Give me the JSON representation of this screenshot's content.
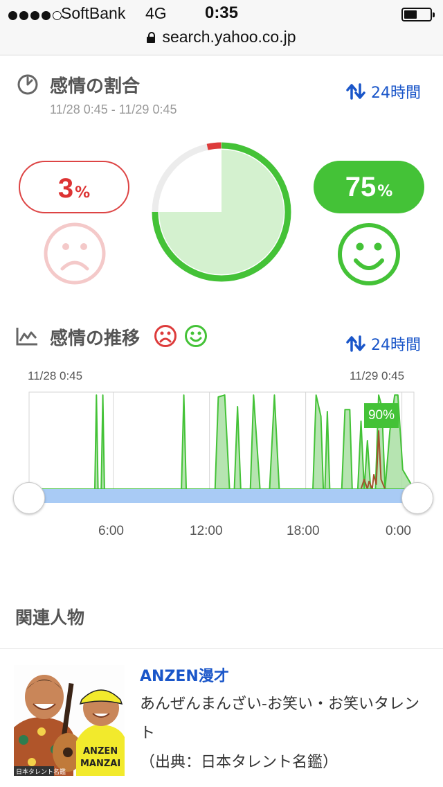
{
  "status_bar": {
    "carrier": "SoftBank",
    "network": "4G",
    "time": "0:35",
    "url": "search.yahoo.co.jp"
  },
  "ratio": {
    "title": "感情の割合",
    "range_label": "24時間",
    "date_range": "11/28 0:45 - 11/29 0:45",
    "negative_value": "3",
    "positive_value": "75",
    "percent_sign": "%",
    "neutral_value": 22
  },
  "trend": {
    "title": "感情の推移",
    "range_label": "24時間",
    "start_date": "11/28 0:45",
    "end_date": "11/29 0:45",
    "peak_label": "90%",
    "hour_labels": [
      "6:00",
      "12:00",
      "18:00",
      "0:00"
    ]
  },
  "chart_data": {
    "type": "area",
    "xlabel": "",
    "ylabel": "",
    "x_range": [
      "11/28 0:45",
      "11/29 0:45"
    ],
    "categories": [
      "6:00",
      "12:00",
      "18:00",
      "0:00"
    ],
    "ylim": [
      0,
      100
    ],
    "series": [
      {
        "points": [
          [
            4.1,
            0
          ],
          [
            4.2,
            97
          ],
          [
            4.3,
            0
          ],
          [
            4.5,
            0
          ],
          [
            4.6,
            97
          ],
          [
            4.7,
            0
          ],
          [
            9.5,
            0
          ],
          [
            9.65,
            97
          ],
          [
            9.8,
            0
          ],
          [
            11.6,
            0
          ],
          [
            11.8,
            95
          ],
          [
            12.2,
            97
          ],
          [
            12.5,
            0
          ],
          [
            12.8,
            0
          ],
          [
            13.0,
            85
          ],
          [
            13.2,
            0
          ],
          [
            13.8,
            0
          ],
          [
            14.0,
            97
          ],
          [
            14.4,
            0
          ],
          [
            15.0,
            0
          ],
          [
            15.3,
            97
          ],
          [
            15.6,
            0
          ],
          [
            17.7,
            0
          ],
          [
            17.9,
            97
          ],
          [
            18.2,
            75
          ],
          [
            18.35,
            0
          ],
          [
            18.45,
            0
          ],
          [
            18.6,
            80
          ],
          [
            18.75,
            0
          ],
          [
            19.5,
            0
          ],
          [
            19.7,
            82
          ],
          [
            20.0,
            82
          ],
          [
            20.15,
            0
          ],
          [
            20.2,
            0
          ],
          [
            20.5,
            0
          ],
          [
            20.7,
            70
          ],
          [
            20.9,
            0
          ],
          [
            21.1,
            50
          ],
          [
            21.3,
            0
          ],
          [
            21.6,
            0
          ],
          [
            21.8,
            97
          ],
          [
            22.0,
            85
          ],
          [
            22.2,
            0
          ],
          [
            22.5,
            60
          ],
          [
            22.8,
            97
          ],
          [
            23.0,
            97
          ],
          [
            23.3,
            20
          ],
          [
            24.0,
            0
          ]
        ]
      },
      {
        "points": [
          [
            20.7,
            0
          ],
          [
            20.9,
            10
          ],
          [
            21.1,
            0
          ],
          [
            21.2,
            8
          ],
          [
            21.4,
            0
          ],
          [
            21.5,
            15
          ],
          [
            21.65,
            5
          ],
          [
            21.8,
            60
          ],
          [
            21.95,
            10
          ],
          [
            22.2,
            0
          ],
          [
            24.0,
            0
          ]
        ]
      }
    ]
  },
  "colors": {
    "positive": "#44c237",
    "positive_fill": "#d4f1cf",
    "negative": "#dd3b3b",
    "negative_soft": "#f4c9c9",
    "link": "#1a56c9",
    "range_bar": "#a9cbf5"
  },
  "related": {
    "title": "関連人物",
    "person": {
      "name": "ANZEN漫才",
      "description": "あんぜんまんざい-お笑い・お笑いタレント",
      "source": "（出典：日本タレント名鑑）",
      "photo_caption": "日本タレント名鑑",
      "shirt_text": "ANZEN MANZAI"
    }
  }
}
